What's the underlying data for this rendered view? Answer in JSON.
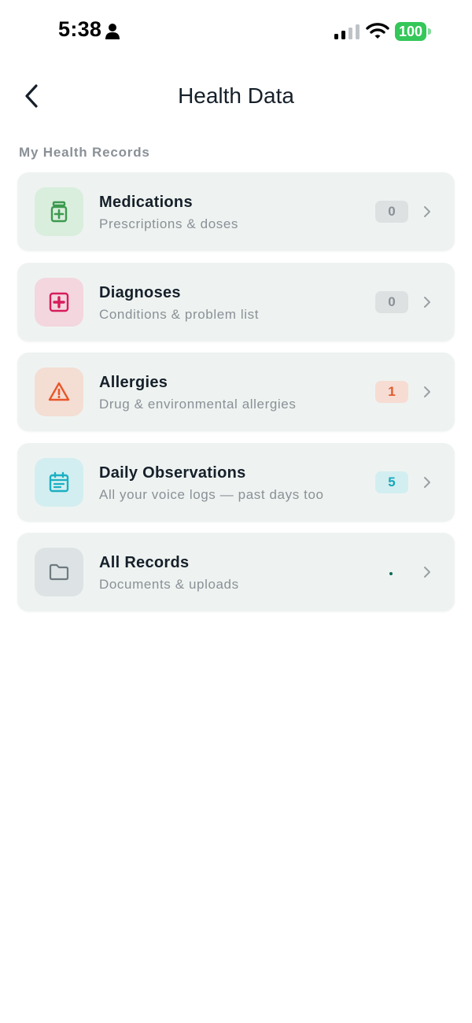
{
  "status_bar": {
    "time": "5:38",
    "battery": "100",
    "icons": [
      "person-icon",
      "cellular-signal-icon",
      "wifi-icon",
      "battery-icon"
    ]
  },
  "header": {
    "title": "Health Data",
    "back_icon": "chevron-left-icon"
  },
  "section": {
    "label": "My Health Records"
  },
  "records": [
    {
      "id": "medications",
      "title": "Medications",
      "subtitle": "Prescriptions & doses",
      "count": "0",
      "icon": "pill-bottle-icon",
      "tile_color": "#d9eedd",
      "icon_color": "#3c9a4e",
      "badge_bg": "#dde1e2",
      "badge_color": "#8a9096"
    },
    {
      "id": "diagnoses",
      "title": "Diagnoses",
      "subtitle": "Conditions & problem list",
      "count": "0",
      "icon": "medical-cross-icon",
      "tile_color": "#f3d6de",
      "icon_color": "#d81b5c",
      "badge_bg": "#dde1e2",
      "badge_color": "#8a9096"
    },
    {
      "id": "allergies",
      "title": "Allergies",
      "subtitle": "Drug & environmental allergies",
      "count": "1",
      "icon": "warning-triangle-icon",
      "tile_color": "#f4ddd3",
      "icon_color": "#e8572a",
      "badge_bg": "#f6dcd2",
      "badge_color": "#e25a2c"
    },
    {
      "id": "daily-observations",
      "title": "Daily Observations",
      "subtitle": "All your voice logs — past days too",
      "count": "5",
      "icon": "calendar-icon",
      "tile_color": "#d3eef0",
      "icon_color": "#1ab0c2",
      "badge_bg": "#d3eef0",
      "badge_color": "#17a7bb"
    },
    {
      "id": "all-records",
      "title": "All Records",
      "subtitle": "Documents & uploads",
      "count": null,
      "loading": true,
      "icon": "folder-icon",
      "tile_color": "#dde3e4",
      "icon_color": "#6f7a80"
    }
  ],
  "row_chevron_icon": "chevron-right-icon"
}
